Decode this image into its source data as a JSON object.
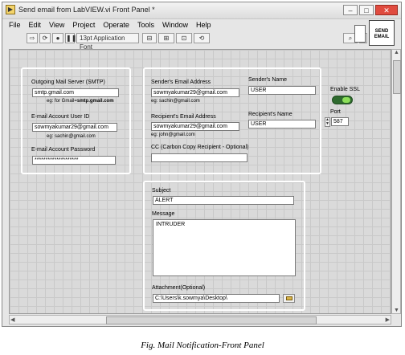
{
  "window": {
    "title": "Send email from LabVIEW.vi Front Panel *",
    "minimize": "–",
    "restore": "□",
    "close": "✕"
  },
  "menu": [
    "File",
    "Edit",
    "View",
    "Project",
    "Operate",
    "Tools",
    "Window",
    "Help"
  ],
  "toolbar": {
    "font": "13pt Application Font",
    "vi_icon_text": "SEND EMAIL"
  },
  "smtp": {
    "server_label": "Outgoing Mail Server (SMTP)",
    "server_value": "smtp.gmail.com",
    "server_hint_prefix": "eg: for Gmail=",
    "server_hint_bold": "smtp.gmail.com",
    "user_label": "E-mail Account User ID",
    "user_value": "sowmyakumar29@gmail.com",
    "user_hint": "eg: sachin@gmail.com",
    "password_label": "E-mail Account Password",
    "password_value": "********************"
  },
  "sender": {
    "email_label": "Sender's Email Address",
    "email_value": "sowmyakumar29@gmail.com",
    "email_hint": "eg: sachin@gmail.com",
    "name_label": "Sender's Name",
    "name_value": "USER"
  },
  "recipient": {
    "email_label": "Recipient's Email Address",
    "email_value": "sowmyakumar29@gmail.com",
    "email_hint": "eg: john@gmail.com",
    "name_label": "Recipient's Name",
    "name_value": "USER",
    "cc_label": "CC (Carbon Copy Recipient - Optional)",
    "cc_value": ""
  },
  "ssl": {
    "label": "Enable SSL",
    "enabled": true
  },
  "port": {
    "label": "Port",
    "value": "587"
  },
  "message": {
    "subject_label": "Subject",
    "subject_value": "ALERT",
    "body_label": "Message",
    "body_value": "INTRUDER",
    "attachment_label": "Attachment(Optional)",
    "attachment_value": "C:\\Users\\k.sowmya\\Desktop\\"
  },
  "caption": "Fig. Mail Notification-Front Panel"
}
